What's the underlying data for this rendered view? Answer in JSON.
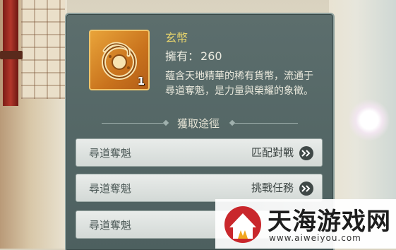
{
  "item": {
    "name": "玄幣",
    "owned_label": "擁有：",
    "owned_value": "260",
    "count_badge": "1",
    "icon": "jade-coin-icon",
    "description": "蘊含天地精華的稀有貨幣，流通于尋道奪魁，是力量與榮耀的象徵。"
  },
  "sources": {
    "title": "獲取途徑",
    "items": [
      {
        "source": "尋道奪魁",
        "action": "匹配對戰"
      },
      {
        "source": "尋道奪魁",
        "action": "挑戰任務"
      },
      {
        "source": "尋道奪魁",
        "action": ""
      }
    ]
  },
  "watermark": {
    "text": "天海游戏网",
    "url": "www.aiweiyou.com"
  },
  "colors": {
    "panel": "#55696a",
    "item_name": "#e7d46c",
    "icon_bg": "#d98a2c"
  }
}
